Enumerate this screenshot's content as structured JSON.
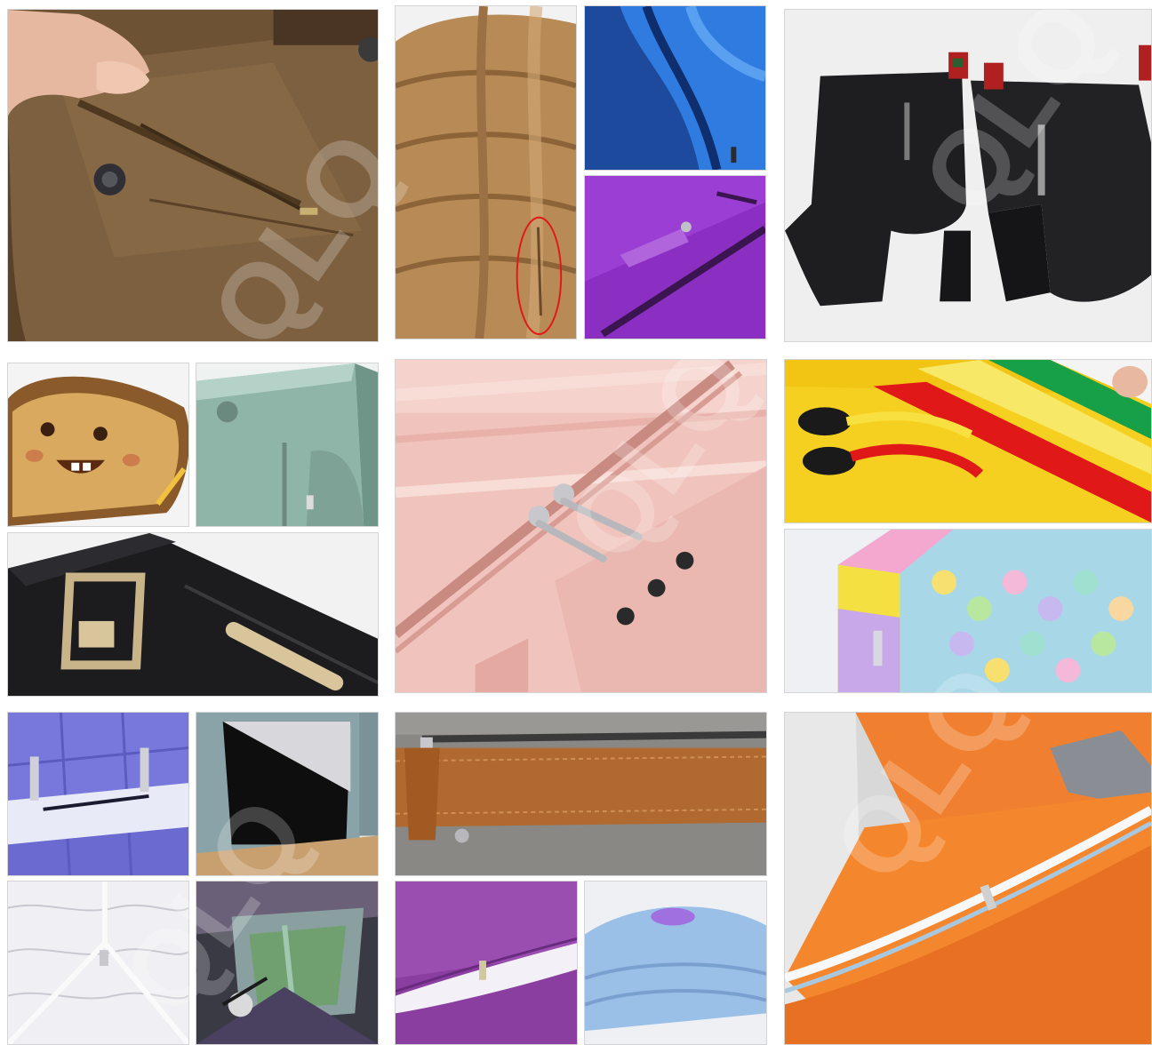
{
  "gallery": {
    "tiles": [
      {
        "id": "coat-pocket-zipper",
        "subject": "brown wool coat pocket zipper"
      },
      {
        "id": "puffer-jacket-zipper",
        "subject": "tan puffer jacket side zipper",
        "highlight": "#e01818"
      },
      {
        "id": "blue-fleece-zipper",
        "subject": "blue fleece jacket collar zipper"
      },
      {
        "id": "purple-bag-zipper",
        "subject": "purple bag pocket zipper"
      },
      {
        "id": "leather-boots-zipper",
        "subject": "black leather ankle boots side zipper"
      },
      {
        "id": "toast-plush-purse",
        "subject": "toast shaped plush coin purse"
      },
      {
        "id": "green-backpack-zipper",
        "subject": "mint green school backpack zipper"
      },
      {
        "id": "black-briefcase-zipper",
        "subject": "black briefcase zipper with gold buckle"
      },
      {
        "id": "pink-suitcase-zipper",
        "subject": "pink suitcase double sliders and combination lock"
      },
      {
        "id": "colorful-pencil-case-zippers",
        "subject": "colorful plastic zippers with rubber pulls"
      },
      {
        "id": "popit-pencil-case",
        "subject": "rainbow pop-it silicone pencil case"
      },
      {
        "id": "blue-bedding-zipper",
        "subject": "blue bedding double slider zipper"
      },
      {
        "id": "storage-box-zipper",
        "subject": "fabric storage cube zipper"
      },
      {
        "id": "leather-pouch-zipper",
        "subject": "tan leather pouch top zipper"
      },
      {
        "id": "lace-curtain-zipper",
        "subject": "white lace mosquito net zipper"
      },
      {
        "id": "tent-window-zipper",
        "subject": "camping tent window zipper"
      },
      {
        "id": "purple-pillow-zipper",
        "subject": "purple pillowcase invisible zipper"
      },
      {
        "id": "blue-cushion-zipper",
        "subject": "folded blue cushion cover"
      },
      {
        "id": "orange-sofa-zipper",
        "subject": "orange sofa cushion zipper"
      }
    ],
    "watermark": {
      "text": "QLQ",
      "color": "#ffffff"
    }
  }
}
